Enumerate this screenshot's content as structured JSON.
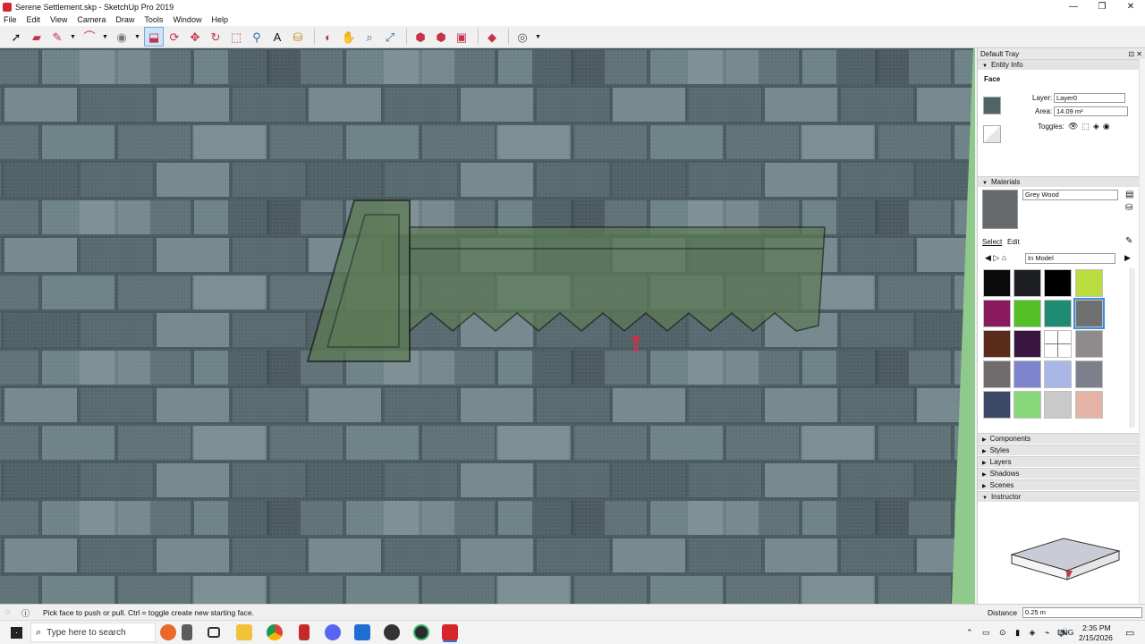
{
  "window": {
    "title": "Serene Settlement.skp - SketchUp Pro 2019",
    "controls": [
      "—",
      "❐",
      "✕"
    ]
  },
  "menu": [
    "File",
    "Edit",
    "View",
    "Camera",
    "Draw",
    "Tools",
    "Window",
    "Help"
  ],
  "tray": {
    "title": "Default Tray",
    "entity_info": {
      "header": "Entity Info",
      "type": "Face",
      "layer_label": "Layer:",
      "layer_value": "Layer0",
      "area_label": "Area:",
      "area_value": "14.09 m²",
      "toggles_label": "Toggles:"
    },
    "materials": {
      "header": "Materials",
      "name": "Grey Wood",
      "tab_select": "Select",
      "tab_edit": "Edit",
      "collection": "In Model",
      "swatch_colors": [
        "#0b0b0b",
        "#1d1f22",
        "#000000",
        "#b9dc3f",
        "#8a1a5e",
        "#52c026",
        "#1f8b73",
        "#6e7170",
        "#5a2a1a",
        "#3a1540",
        "#ffffff",
        "#8f8a8b",
        "#6f6a6c",
        "#7d86cc",
        "#a9b7e6",
        "#7c7f8c",
        "#3b4866",
        "#8ad67a",
        "#c9c9c9",
        "#e4b3a6"
      ]
    },
    "collapsed_panels": [
      "Components",
      "Styles",
      "Layers",
      "Shadows",
      "Scenes"
    ],
    "instructor": {
      "header": "Instructor"
    }
  },
  "status": {
    "message": "Pick face to push or pull.  Ctrl = toggle create new starting face.",
    "measurement_label": "Distance",
    "measurement_value": "0.25 m"
  },
  "taskbar": {
    "search_placeholder": "Type here to search",
    "language": "ENG",
    "time": "2:35 PM",
    "date": "2/15/2026"
  }
}
